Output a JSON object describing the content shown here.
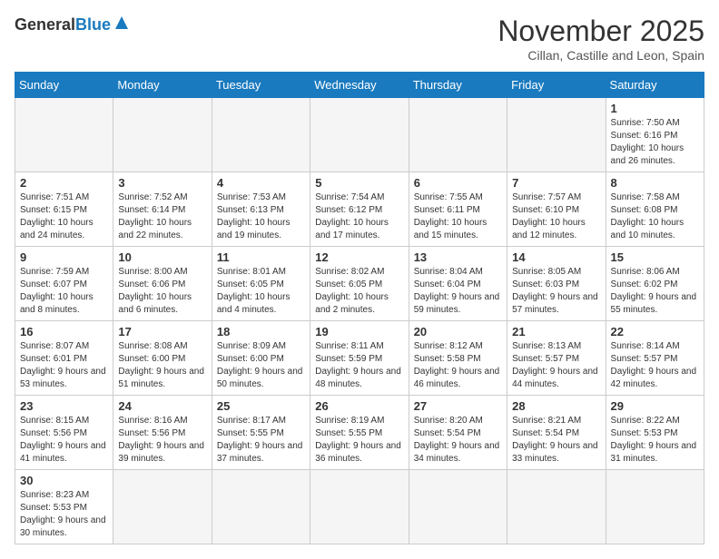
{
  "header": {
    "logo_general": "General",
    "logo_blue": "Blue",
    "month_title": "November 2025",
    "subtitle": "Cillan, Castille and Leon, Spain"
  },
  "days_of_week": [
    "Sunday",
    "Monday",
    "Tuesday",
    "Wednesday",
    "Thursday",
    "Friday",
    "Saturday"
  ],
  "weeks": [
    [
      {
        "day": "",
        "info": ""
      },
      {
        "day": "",
        "info": ""
      },
      {
        "day": "",
        "info": ""
      },
      {
        "day": "",
        "info": ""
      },
      {
        "day": "",
        "info": ""
      },
      {
        "day": "",
        "info": ""
      },
      {
        "day": "1",
        "info": "Sunrise: 7:50 AM\nSunset: 6:16 PM\nDaylight: 10 hours and 26 minutes."
      }
    ],
    [
      {
        "day": "2",
        "info": "Sunrise: 7:51 AM\nSunset: 6:15 PM\nDaylight: 10 hours and 24 minutes."
      },
      {
        "day": "3",
        "info": "Sunrise: 7:52 AM\nSunset: 6:14 PM\nDaylight: 10 hours and 22 minutes."
      },
      {
        "day": "4",
        "info": "Sunrise: 7:53 AM\nSunset: 6:13 PM\nDaylight: 10 hours and 19 minutes."
      },
      {
        "day": "5",
        "info": "Sunrise: 7:54 AM\nSunset: 6:12 PM\nDaylight: 10 hours and 17 minutes."
      },
      {
        "day": "6",
        "info": "Sunrise: 7:55 AM\nSunset: 6:11 PM\nDaylight: 10 hours and 15 minutes."
      },
      {
        "day": "7",
        "info": "Sunrise: 7:57 AM\nSunset: 6:10 PM\nDaylight: 10 hours and 12 minutes."
      },
      {
        "day": "8",
        "info": "Sunrise: 7:58 AM\nSunset: 6:08 PM\nDaylight: 10 hours and 10 minutes."
      }
    ],
    [
      {
        "day": "9",
        "info": "Sunrise: 7:59 AM\nSunset: 6:07 PM\nDaylight: 10 hours and 8 minutes."
      },
      {
        "day": "10",
        "info": "Sunrise: 8:00 AM\nSunset: 6:06 PM\nDaylight: 10 hours and 6 minutes."
      },
      {
        "day": "11",
        "info": "Sunrise: 8:01 AM\nSunset: 6:05 PM\nDaylight: 10 hours and 4 minutes."
      },
      {
        "day": "12",
        "info": "Sunrise: 8:02 AM\nSunset: 6:05 PM\nDaylight: 10 hours and 2 minutes."
      },
      {
        "day": "13",
        "info": "Sunrise: 8:04 AM\nSunset: 6:04 PM\nDaylight: 9 hours and 59 minutes."
      },
      {
        "day": "14",
        "info": "Sunrise: 8:05 AM\nSunset: 6:03 PM\nDaylight: 9 hours and 57 minutes."
      },
      {
        "day": "15",
        "info": "Sunrise: 8:06 AM\nSunset: 6:02 PM\nDaylight: 9 hours and 55 minutes."
      }
    ],
    [
      {
        "day": "16",
        "info": "Sunrise: 8:07 AM\nSunset: 6:01 PM\nDaylight: 9 hours and 53 minutes."
      },
      {
        "day": "17",
        "info": "Sunrise: 8:08 AM\nSunset: 6:00 PM\nDaylight: 9 hours and 51 minutes."
      },
      {
        "day": "18",
        "info": "Sunrise: 8:09 AM\nSunset: 6:00 PM\nDaylight: 9 hours and 50 minutes."
      },
      {
        "day": "19",
        "info": "Sunrise: 8:11 AM\nSunset: 5:59 PM\nDaylight: 9 hours and 48 minutes."
      },
      {
        "day": "20",
        "info": "Sunrise: 8:12 AM\nSunset: 5:58 PM\nDaylight: 9 hours and 46 minutes."
      },
      {
        "day": "21",
        "info": "Sunrise: 8:13 AM\nSunset: 5:57 PM\nDaylight: 9 hours and 44 minutes."
      },
      {
        "day": "22",
        "info": "Sunrise: 8:14 AM\nSunset: 5:57 PM\nDaylight: 9 hours and 42 minutes."
      }
    ],
    [
      {
        "day": "23",
        "info": "Sunrise: 8:15 AM\nSunset: 5:56 PM\nDaylight: 9 hours and 41 minutes."
      },
      {
        "day": "24",
        "info": "Sunrise: 8:16 AM\nSunset: 5:56 PM\nDaylight: 9 hours and 39 minutes."
      },
      {
        "day": "25",
        "info": "Sunrise: 8:17 AM\nSunset: 5:55 PM\nDaylight: 9 hours and 37 minutes."
      },
      {
        "day": "26",
        "info": "Sunrise: 8:19 AM\nSunset: 5:55 PM\nDaylight: 9 hours and 36 minutes."
      },
      {
        "day": "27",
        "info": "Sunrise: 8:20 AM\nSunset: 5:54 PM\nDaylight: 9 hours and 34 minutes."
      },
      {
        "day": "28",
        "info": "Sunrise: 8:21 AM\nSunset: 5:54 PM\nDaylight: 9 hours and 33 minutes."
      },
      {
        "day": "29",
        "info": "Sunrise: 8:22 AM\nSunset: 5:53 PM\nDaylight: 9 hours and 31 minutes."
      }
    ],
    [
      {
        "day": "30",
        "info": "Sunrise: 8:23 AM\nSunset: 5:53 PM\nDaylight: 9 hours and 30 minutes."
      },
      {
        "day": "",
        "info": ""
      },
      {
        "day": "",
        "info": ""
      },
      {
        "day": "",
        "info": ""
      },
      {
        "day": "",
        "info": ""
      },
      {
        "day": "",
        "info": ""
      },
      {
        "day": "",
        "info": ""
      }
    ]
  ]
}
